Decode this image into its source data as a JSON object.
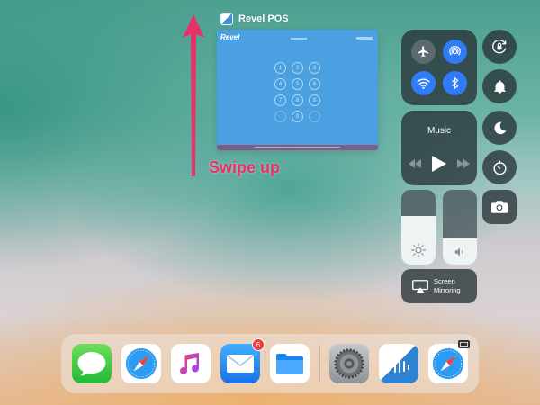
{
  "annotation": {
    "label": "Swipe up",
    "color": "#e8306a"
  },
  "app_switcher": {
    "app_name": "Revel POS",
    "card": {
      "logo_text": "Revel",
      "keypad_keys": [
        "1",
        "2",
        "3",
        "4",
        "5",
        "6",
        "7",
        "8",
        "9",
        "",
        "0",
        ""
      ],
      "background_color": "#4aa0e0"
    }
  },
  "control_center": {
    "connectivity": [
      {
        "name": "airplane-mode",
        "icon": "airplane-icon",
        "state": "off"
      },
      {
        "name": "airdrop",
        "icon": "airdrop-icon",
        "state": "on"
      },
      {
        "name": "wifi",
        "icon": "wifi-icon",
        "state": "on"
      },
      {
        "name": "bluetooth",
        "icon": "bluetooth-icon",
        "state": "on"
      }
    ],
    "music": {
      "title": "Music",
      "controls": [
        "rewind-icon",
        "play-icon",
        "fast-forward-icon"
      ]
    },
    "orientation_lock": {
      "icon": "rotation-lock-icon"
    },
    "silent": {
      "icon": "bell-icon"
    },
    "do_not_disturb": {
      "icon": "moon-icon"
    },
    "timer": {
      "icon": "timer-icon"
    },
    "camera": {
      "icon": "camera-icon"
    },
    "brightness": {
      "icon": "sun-icon",
      "level": 0.65
    },
    "volume": {
      "icon": "speaker-icon",
      "level": 0.35
    },
    "screen_mirroring": {
      "line1": "Screen",
      "line2": "Mirroring",
      "icon": "airplay-icon"
    },
    "active_color": "#2f7cf6"
  },
  "dock": {
    "apps": [
      {
        "name": "Messages",
        "icon": "messages-icon"
      },
      {
        "name": "Safari",
        "icon": "safari-icon"
      },
      {
        "name": "Music",
        "icon": "music-icon"
      },
      {
        "name": "Mail",
        "icon": "mail-icon",
        "badge": "6"
      },
      {
        "name": "Files",
        "icon": "files-icon"
      },
      {
        "name": "Settings",
        "icon": "settings-icon"
      },
      {
        "name": "Revel POS",
        "icon": "revel-pos-icon"
      },
      {
        "name": "Safari",
        "icon": "safari-icon"
      }
    ]
  }
}
